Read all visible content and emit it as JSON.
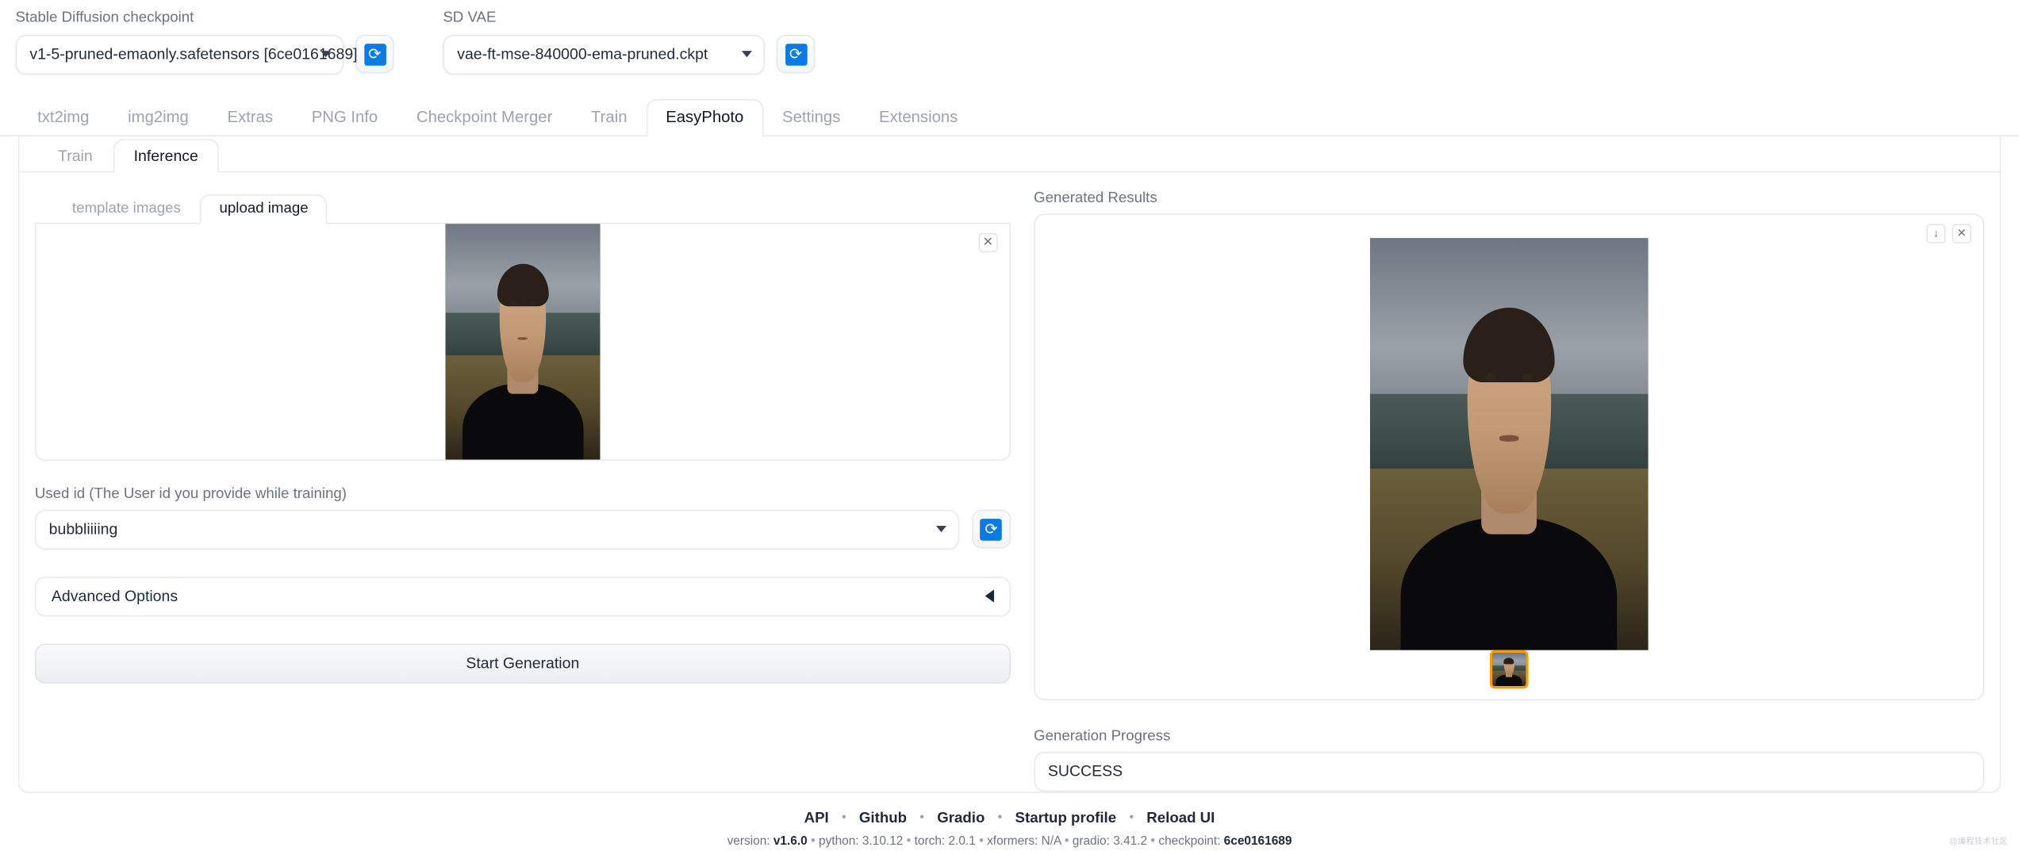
{
  "topbar": {
    "checkpoint": {
      "label": "Stable Diffusion checkpoint",
      "value": "v1-5-pruned-emaonly.safetensors [6ce0161689]",
      "refresh_icon": "refresh-icon"
    },
    "vae": {
      "label": "SD VAE",
      "value": "vae-ft-mse-840000-ema-pruned.ckpt",
      "refresh_icon": "refresh-icon"
    }
  },
  "main_tabs": [
    {
      "label": "txt2img",
      "active": false
    },
    {
      "label": "img2img",
      "active": false
    },
    {
      "label": "Extras",
      "active": false
    },
    {
      "label": "PNG Info",
      "active": false
    },
    {
      "label": "Checkpoint Merger",
      "active": false
    },
    {
      "label": "Train",
      "active": false
    },
    {
      "label": "EasyPhoto",
      "active": true
    },
    {
      "label": "Settings",
      "active": false
    },
    {
      "label": "Extensions",
      "active": false
    }
  ],
  "sub_tabs": [
    {
      "label": "Train",
      "active": false
    },
    {
      "label": "Inference",
      "active": true
    }
  ],
  "image_tabs": [
    {
      "label": "template images",
      "active": false
    },
    {
      "label": "upload image",
      "active": true
    }
  ],
  "upload": {
    "close_icon": "close-icon",
    "image_alt": "uploaded-portrait-photo"
  },
  "used_id": {
    "label": "Used id (The User id you provide while training)",
    "value": "bubbliiiing",
    "caret_icon": "chevron-down-icon",
    "refresh_icon": "refresh-icon"
  },
  "advanced_options": {
    "label": "Advanced Options",
    "arrow_icon": "triangle-left-icon",
    "expanded": false
  },
  "start_generation": {
    "label": "Start Generation"
  },
  "results": {
    "label": "Generated Results",
    "download_icon": "download-icon",
    "close_icon": "close-icon",
    "image_alt": "generated-portrait-result",
    "thumbnail_alt": "result-thumbnail-1"
  },
  "progress": {
    "label": "Generation Progress",
    "value": "SUCCESS"
  },
  "footer": {
    "links": [
      "API",
      "Github",
      "Gradio",
      "Startup profile",
      "Reload UI"
    ],
    "separator": "•",
    "version_items": [
      {
        "key": "version:",
        "value": "v1.6.0",
        "bold": true
      },
      {
        "key": "python:",
        "value": "3.10.12",
        "bold": false
      },
      {
        "key": "torch:",
        "value": "2.0.1",
        "bold": false
      },
      {
        "key": "xformers:",
        "value": "N/A",
        "bold": false
      },
      {
        "key": "gradio:",
        "value": "3.41.2",
        "bold": false
      },
      {
        "key": "checkpoint:",
        "value": "6ce0161689",
        "bold": true
      }
    ]
  },
  "watermark": {
    "text": "@编程技术社区"
  },
  "colors": {
    "accent": "#0b7ae5",
    "thumb_border": "#f59e0b",
    "text": "#1f2937",
    "muted": "#6b7280",
    "border": "#e7e9ee"
  }
}
